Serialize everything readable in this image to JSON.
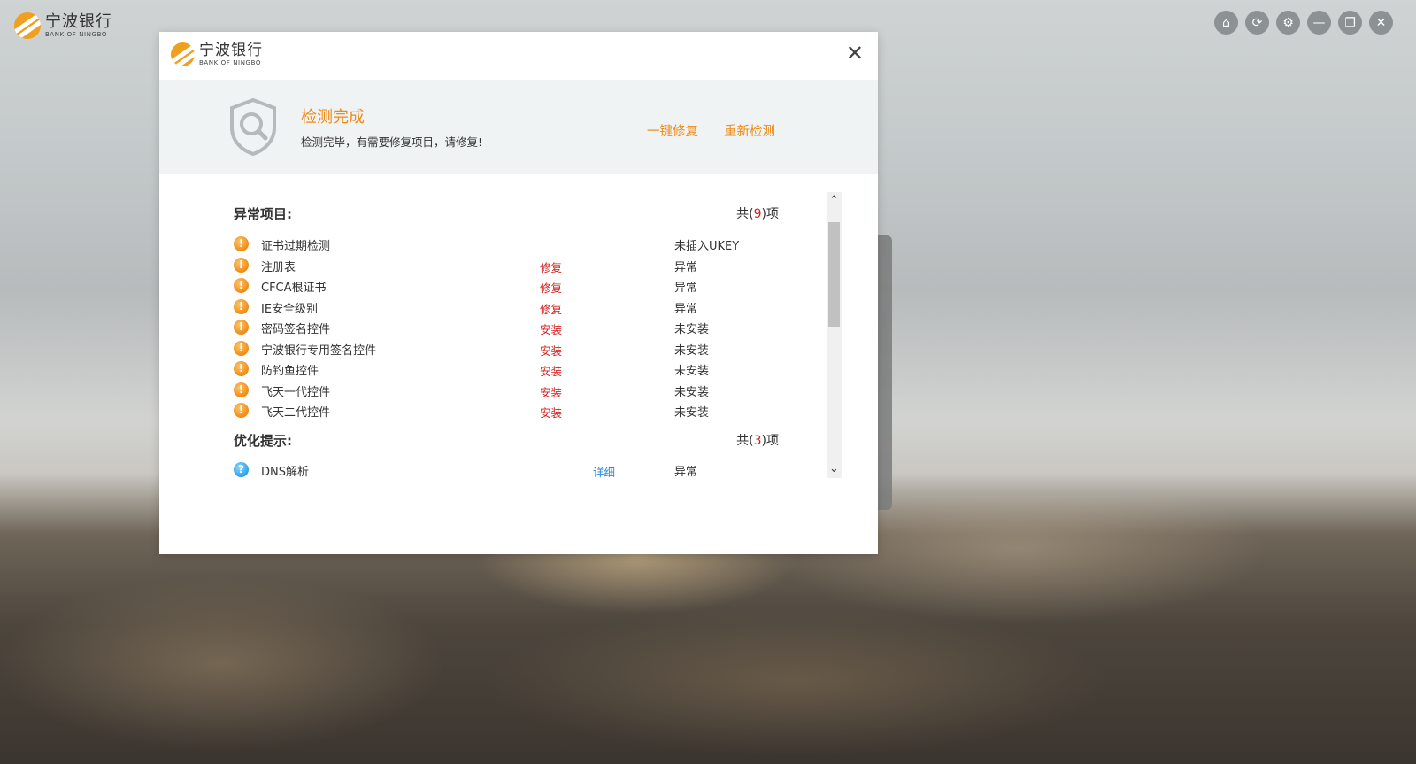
{
  "app": {
    "logo_cn": "宁波银行",
    "logo_en": "BANK OF NINGBO"
  },
  "window_controls": [
    {
      "name": "home-icon",
      "glyph": "⌂"
    },
    {
      "name": "refresh-icon",
      "glyph": "⟳"
    },
    {
      "name": "gear-icon",
      "glyph": "⚙"
    },
    {
      "name": "minimize-icon",
      "glyph": "—"
    },
    {
      "name": "restore-icon",
      "glyph": "❐"
    },
    {
      "name": "close-icon",
      "glyph": "✕"
    }
  ],
  "dialog": {
    "logo_cn": "宁波银行",
    "logo_en": "BANK OF NINGBO",
    "close_glyph": "✕",
    "status_title": "检测完成",
    "status_sub": "检测完毕，有需要修复项目，请修复!",
    "fix_all_label": "一键修复",
    "recheck_label": "重新检测",
    "abnormal": {
      "title": "异常项目:",
      "count_prefix": "共(",
      "count": "9",
      "count_suffix": ")项",
      "items": [
        {
          "name": "证书过期检测",
          "action": "",
          "status": "未插入UKEY"
        },
        {
          "name": "注册表",
          "action": "修复",
          "status": "异常"
        },
        {
          "name": "CFCA根证书",
          "action": "修复",
          "status": "异常"
        },
        {
          "name": "IE安全级别",
          "action": "修复",
          "status": "异常"
        },
        {
          "name": "密码签名控件",
          "action": "安装",
          "status": "未安装"
        },
        {
          "name": "宁波银行专用签名控件",
          "action": "安装",
          "status": "未安装"
        },
        {
          "name": "防钓鱼控件",
          "action": "安装",
          "status": "未安装"
        },
        {
          "name": "飞天一代控件",
          "action": "安装",
          "status": "未安装"
        },
        {
          "name": "飞天二代控件",
          "action": "安装",
          "status": "未安装"
        }
      ]
    },
    "optimize": {
      "title": "优化提示:",
      "count_prefix": "共(",
      "count": "3",
      "count_suffix": ")项",
      "items": [
        {
          "name": "DNS解析",
          "action": "详细",
          "status": "异常"
        }
      ]
    },
    "icon_glyphs": {
      "warning": "!",
      "question": "?"
    },
    "scroll_up": "⌃",
    "scroll_down": "⌄"
  },
  "colors": {
    "accent_orange": "#ef8a14",
    "alert_red": "#d21e1e",
    "link_blue": "#2a86d8"
  }
}
